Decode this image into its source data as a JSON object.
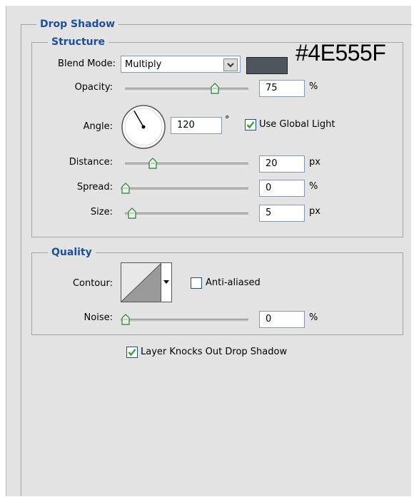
{
  "drop_shadow": {
    "title": "Drop Shadow",
    "structure": {
      "title": "Structure",
      "blend_mode": {
        "label": "Blend Mode:",
        "value": "Multiply"
      },
      "color": {
        "hex": "#4E555F",
        "annotation": "#4E555F"
      },
      "opacity": {
        "label": "Opacity:",
        "value": "75",
        "unit": "%",
        "level": 0.75
      },
      "angle": {
        "label": "Angle:",
        "value": "120",
        "unit": "°",
        "degrees": 120
      },
      "use_global_light": {
        "label": "Use Global Light",
        "checked": true
      },
      "distance": {
        "label": "Distance:",
        "value": "20",
        "unit": "px",
        "level": 0.2
      },
      "spread": {
        "label": "Spread:",
        "value": "0",
        "unit": "%",
        "level": 0
      },
      "size": {
        "label": "Size:",
        "value": "5",
        "unit": "px",
        "level": 0.02
      }
    },
    "quality": {
      "title": "Quality",
      "contour": {
        "label": "Contour:"
      },
      "anti_aliased": {
        "label": "Anti-aliased",
        "checked": false
      },
      "noise": {
        "label": "Noise:",
        "value": "0",
        "unit": "%",
        "level": 0
      }
    },
    "layer_knocks_out": {
      "label": "Layer Knocks Out Drop Shadow",
      "checked": true
    }
  }
}
